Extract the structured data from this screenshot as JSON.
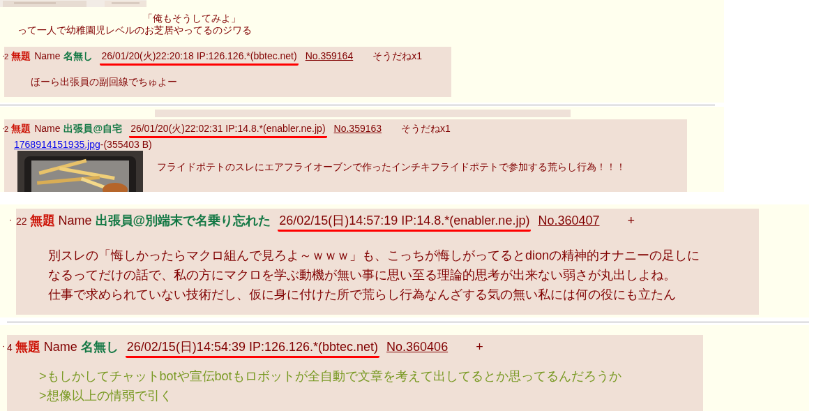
{
  "fragment": {
    "lines": [
      {
        "text": "「俺もそうしてみよ」",
        "indent": true
      },
      {
        "text": "って一人で幼稚園児レベルのお芝居やってるのジワる",
        "indent": false
      }
    ]
  },
  "posts": [
    {
      "marker": "・",
      "index": "2",
      "subject": "無題",
      "name_label": "Name",
      "name": "名無し",
      "date": "26/01/20(火)22:20:18 IP:126.126.*(bbtec.net)",
      "underlined": true,
      "number": "No.359164",
      "reaction": "そうだねx1",
      "body": [
        {
          "kind": "plain",
          "text": "ほーら出張員の副回線でちゅよー"
        }
      ]
    },
    {
      "marker": "・",
      "index": "2",
      "subject": "無題",
      "name_label": "Name",
      "name": "出張員@自宅",
      "date": "26/01/20(火)22:02:31 IP:14.8.*(enabler.ne.jp)",
      "underlined": true,
      "number": "No.359163",
      "reaction": "そうだねx1",
      "file": {
        "name": "1768914151935.jpg",
        "size": "-(355403 B)"
      },
      "body": [
        {
          "kind": "plain",
          "text": "フライドポテトのスレにエアフライオーブンで作ったインチキフライドポテトで参加する荒らし行為！！！"
        }
      ]
    },
    {
      "marker": "・",
      "index": "22",
      "subject": "無題",
      "name_label": "Name",
      "name": "出張員@別端末で名乗り忘れた",
      "date": "26/02/15(日)14:57:19 IP:14.8.*(enabler.ne.jp)",
      "underlined": true,
      "number": "No.360407",
      "reaction": "+",
      "body": [
        {
          "kind": "plain",
          "text": "別スレの「悔しかったらマクロ組んで見ろよ～ｗｗｗ」も、こっちが悔しがってるとdionの精神的オナニーの足しになるってだけの話で、私の方にマクロを学ぶ動機が無い事に思い至る理論的思考が出来ない弱さが丸出しよね。"
        },
        {
          "kind": "plain",
          "text": "仕事で求められていない技術だし、仮に身に付けた所で荒らし行為なんざする気の無い私には何の役にも立たん"
        }
      ]
    },
    {
      "marker": "・",
      "index": "4",
      "subject": "無題",
      "name_label": "Name",
      "name": "名無し",
      "date": "26/02/15(日)14:54:39 IP:126.126.*(bbtec.net)",
      "underlined": true,
      "number": "No.360406",
      "reaction": "+",
      "body": [
        {
          "kind": "quote",
          "text": ">もしかしてチャットbotや宣伝botもロボットが全自動で文章を考えて出してるとか思ってるんだろうか"
        },
        {
          "kind": "quote",
          "text": ">想像以上の情弱で引く"
        }
      ]
    }
  ]
}
